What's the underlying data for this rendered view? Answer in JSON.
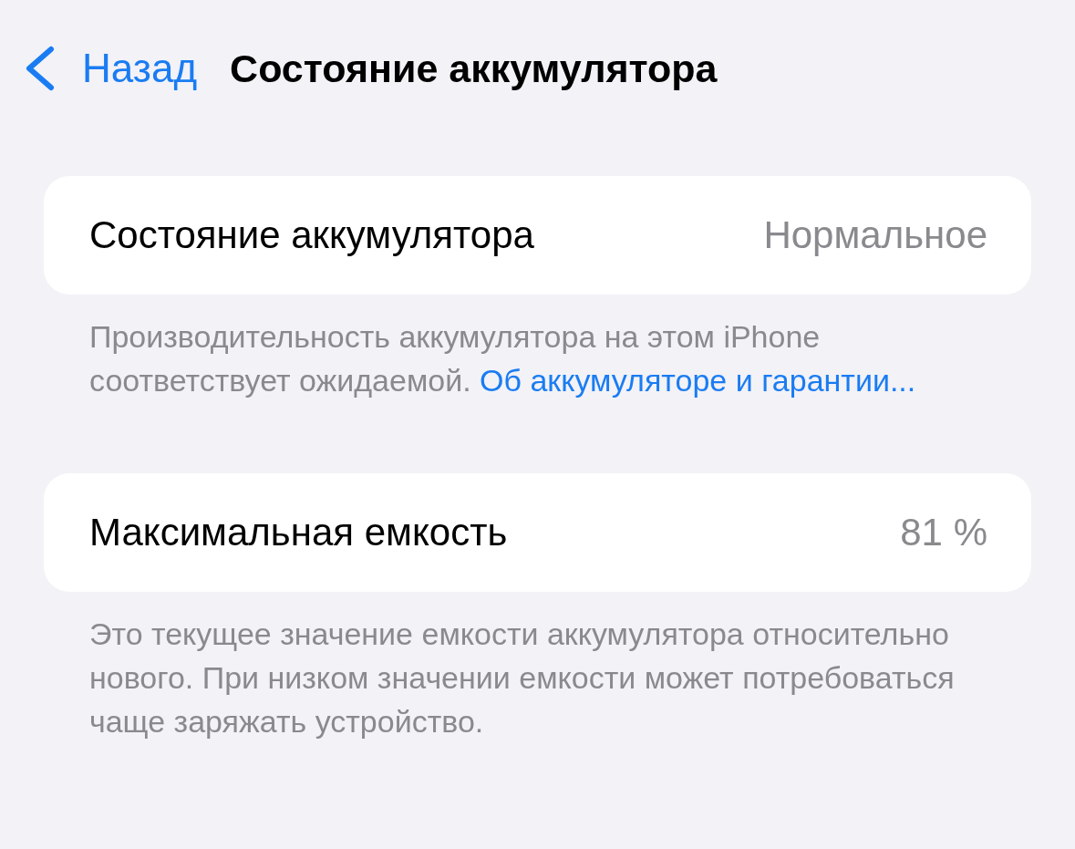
{
  "nav": {
    "back": "Назад",
    "title": "Состояние аккумулятора"
  },
  "sections": [
    {
      "label": "Состояние аккумулятора",
      "value": "Нормальное",
      "footer": "Производительность аккумулятора на этом iPhone соответствует ожидаемой.",
      "footer_link": "Об аккумуляторе и гарантии..."
    },
    {
      "label": "Максимальная емкость",
      "value": "81 %",
      "footer": "Это текущее значение емкости аккумулятора относительно нового. При низком значении емкости может потребоваться чаще заряжать устройство."
    }
  ]
}
